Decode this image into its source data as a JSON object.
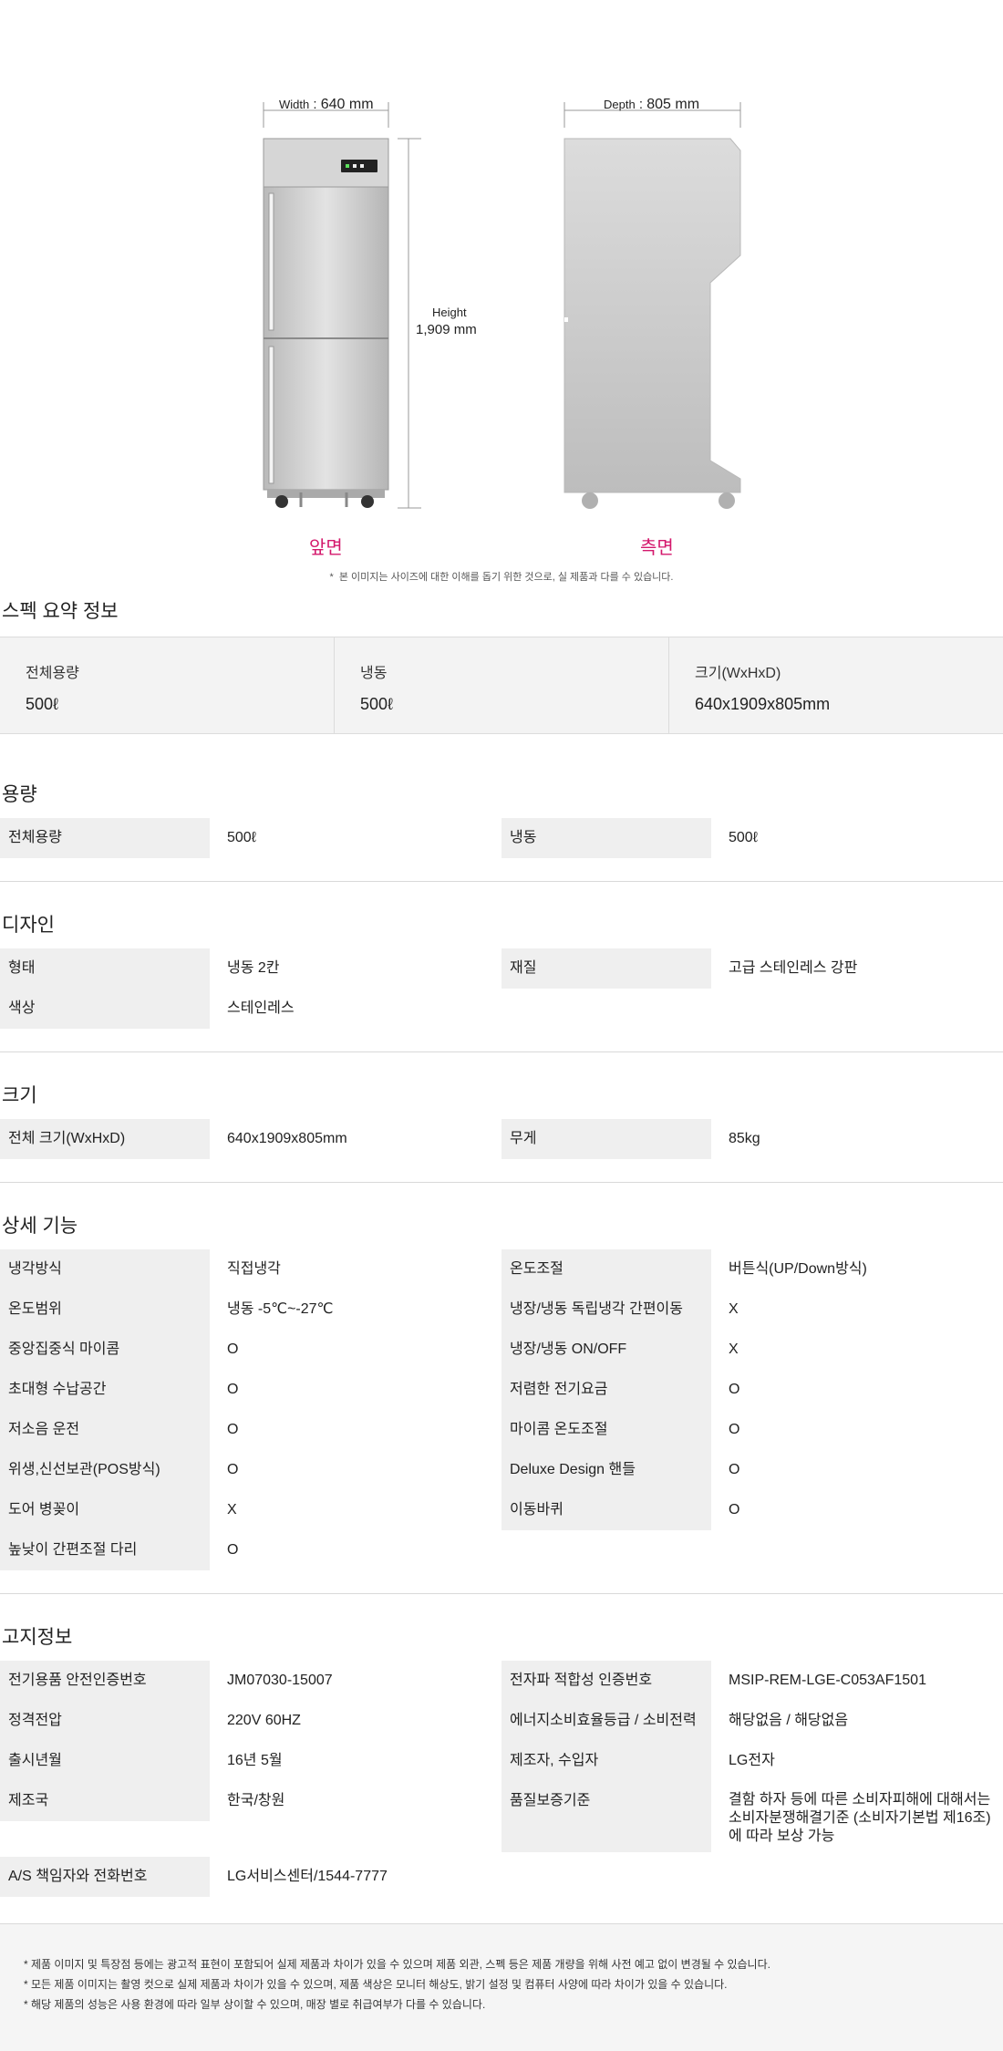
{
  "diagram": {
    "width_label": "Width",
    "width_value": "640 mm",
    "depth_label": "Depth",
    "depth_value": "805 mm",
    "height_label": "Height",
    "height_value": "1,909 mm",
    "front_label": "앞면",
    "side_label": "측면",
    "disclaimer": "본 이미지는 사이즈에 대한 이해를 돕기 위한 것으로, 실 제품과 다를 수 있습니다.",
    "colors": {
      "accent": "#d4186c",
      "body": "#c9c9c9"
    }
  },
  "summary": {
    "title": "스펙 요약 정보",
    "items": [
      {
        "label": "전체용량",
        "value": "500ℓ"
      },
      {
        "label": "냉동",
        "value": "500ℓ"
      },
      {
        "label": "크기(WxHxD)",
        "value": "640x1909x805mm"
      }
    ]
  },
  "capacity": {
    "title": "용량",
    "rows": [
      {
        "l_label": "전체용량",
        "l_value": "500ℓ",
        "r_label": "냉동",
        "r_value": "500ℓ"
      }
    ]
  },
  "design": {
    "title": "디자인",
    "rows": [
      {
        "l_label": "형태",
        "l_value": "냉동 2칸",
        "r_label": "재질",
        "r_value": "고급 스테인레스 강판"
      },
      {
        "l_label": "색상",
        "l_value": "스테인레스",
        "r_label": "",
        "r_value": ""
      }
    ]
  },
  "size": {
    "title": "크기",
    "rows": [
      {
        "l_label": "전체 크기(WxHxD)",
        "l_value": "640x1909x805mm",
        "r_label": "무게",
        "r_value": "85kg"
      }
    ]
  },
  "features": {
    "title": "상세 기능",
    "rows": [
      {
        "l_label": "냉각방식",
        "l_value": "직접냉각",
        "r_label": "온도조절",
        "r_value": "버튼식(UP/Down방식)"
      },
      {
        "l_label": "온도범위",
        "l_value": "냉동 -5℃~-27℃",
        "r_label": "냉장/냉동 독립냉각 간편이동",
        "r_value": "X"
      },
      {
        "l_label": "중앙집중식 마이콤",
        "l_value": "O",
        "r_label": "냉장/냉동 ON/OFF",
        "r_value": "X"
      },
      {
        "l_label": "초대형 수납공간",
        "l_value": "O",
        "r_label": "저렴한 전기요금",
        "r_value": "O"
      },
      {
        "l_label": "저소음 운전",
        "l_value": "O",
        "r_label": "마이콤 온도조절",
        "r_value": "O"
      },
      {
        "l_label": "위생,신선보관(POS방식)",
        "l_value": "O",
        "r_label": "Deluxe Design 핸들",
        "r_value": "O"
      },
      {
        "l_label": "도어 병꽂이",
        "l_value": "X",
        "r_label": "이동바퀴",
        "r_value": "O"
      },
      {
        "l_label": "높낮이 간편조절 다리",
        "l_value": "O",
        "r_label": "",
        "r_value": ""
      }
    ]
  },
  "notice": {
    "title": "고지정보",
    "rows": [
      {
        "l_label": "전기용품 안전인증번호",
        "l_value": "JM07030-15007",
        "r_label": "전자파 적합성 인증번호",
        "r_value": "MSIP-REM-LGE-C053AF1501"
      },
      {
        "l_label": "정격전압",
        "l_value": "220V 60HZ",
        "r_label": "에너지소비효율등급 / 소비전력",
        "r_value": "해당없음 / 해당없음"
      },
      {
        "l_label": "출시년월",
        "l_value": "16년 5월",
        "r_label": "제조자, 수입자",
        "r_value": "LG전자"
      },
      {
        "l_label": "제조국",
        "l_value": "한국/창원",
        "r_label": "품질보증기준",
        "r_value": "결함 하자 등에 따른 소비자피해에 대해서는 소비자분쟁해결기준 (소비자기본법 제16조)에 따라 보상 가능"
      },
      {
        "l_label": "A/S 책임자와 전화번호",
        "l_value": "LG서비스센터/1544-7777",
        "r_label": "",
        "r_value": ""
      }
    ]
  },
  "footer": {
    "notes": [
      "제품 이미지 및 특장점 등에는 광고적 표현이 포함되어 실제 제품과 차이가 있을 수 있으며 제품 외관, 스펙 등은 제품 개량을 위해 사전 예고 없이 변경될 수 있습니다.",
      "모든 제품 이미지는 촬영 컷으로 실제 제품과 차이가 있을 수 있으며, 제품 색상은 모니터 해상도, 밝기 설정 및 컴퓨터 사양에 따라 차이가 있을 수 있습니다.",
      "해당 제품의 성능은 사용 환경에 따라 일부 상이할 수 있으며, 매장 별로 취급여부가 다를 수 있습니다."
    ]
  }
}
